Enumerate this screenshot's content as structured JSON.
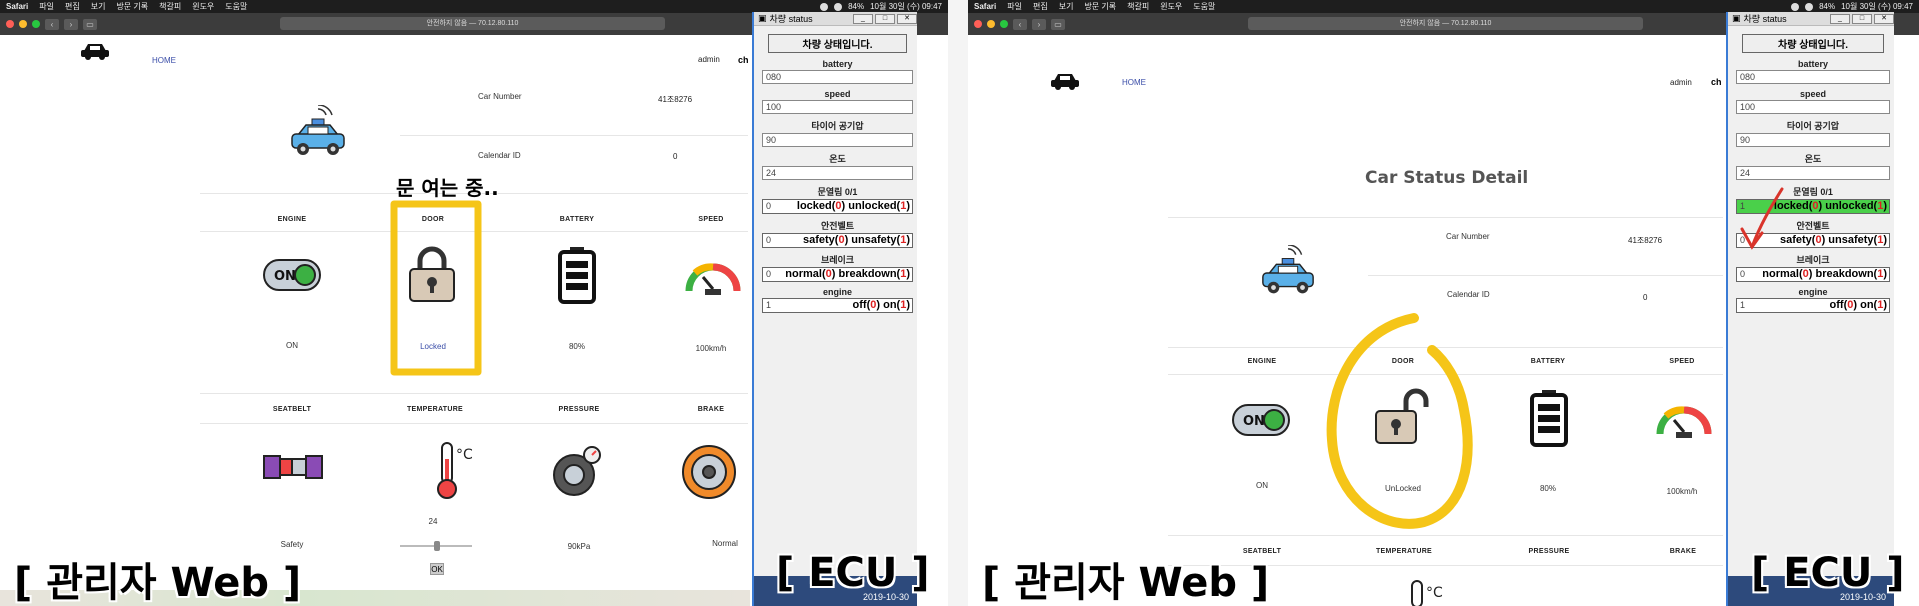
{
  "menubar": {
    "app": "Safari",
    "items": [
      "파일",
      "편집",
      "보기",
      "방문 기록",
      "책갈피",
      "윈도우",
      "도움말"
    ],
    "battery": "84%",
    "datetime": "10월 30일 (수) 09:47"
  },
  "browser": {
    "url": "안전하지 않음 — 70.12.80.110"
  },
  "nav": {
    "home": "HOME",
    "admin": "admin",
    "truncated": "ch"
  },
  "page": {
    "title": "Car Status Detail",
    "car_number_label": "Car Number",
    "car_number_value": "41조8276",
    "calendar_label": "Calendar ID",
    "calendar_value": "0"
  },
  "status_row1": {
    "headers": [
      "ENGINE",
      "DOOR",
      "BATTERY",
      "SPEED"
    ],
    "left_values": [
      "ON",
      "Locked",
      "80%",
      "100km/h"
    ],
    "right_values": [
      "ON",
      "UnLocked",
      "80%",
      "100km/h"
    ]
  },
  "status_row2": {
    "headers": [
      "SEATBELT",
      "TEMPERATURE",
      "PRESSURE",
      "BRAKE"
    ],
    "values": [
      "Safety",
      "",
      "90kPa",
      "Normal"
    ],
    "temperature_value": "24",
    "ok_button": "OK"
  },
  "ecu": {
    "window_title": "차량 status",
    "header": "차량 상태입니다.",
    "battery_label": "battery",
    "battery_value": "080",
    "speed_label": "speed",
    "speed_value": "100",
    "tire_label": "타이어 공기압",
    "tire_value": "90",
    "temp_label": "온도",
    "temp_value": "24",
    "door_label": "문열림 0/1",
    "door_left_value": "0",
    "door_right_value": "1",
    "door_opt_a": "locked(",
    "door_opt_b": "0",
    "door_opt_c": ") unlocked(",
    "door_opt_d": "1",
    "door_opt_e": ")",
    "belt_label": "안전벨트",
    "belt_value": "0",
    "belt_opt_a": "safety(",
    "belt_opt_b": "0",
    "belt_opt_c": ") unsafety(",
    "belt_opt_d": "1",
    "belt_opt_e": ")",
    "brake_label": "브레이크",
    "brake_value": "0",
    "brake_opt_a": "normal(",
    "brake_opt_b": "0",
    "brake_opt_c": ") breakdown(",
    "brake_opt_d": "1",
    "brake_opt_e": ")",
    "engine_label": "engine",
    "engine_value": "1",
    "engine_opt_a": "off(",
    "engine_opt_b": "0",
    "engine_opt_c": ") on(",
    "engine_opt_d": "1",
    "engine_opt_e": ")",
    "taskbar_date": "2019-10-30"
  },
  "overlays": {
    "left_admin": "[ 관리자 Web ]",
    "left_ecu": "[ ECU ]",
    "right_admin": "[ 관리자 Web ]",
    "right_ecu": "[ ECU ]",
    "door_opening": "문 여는 중.."
  },
  "colors": {
    "highlight_yellow": "#f5c518",
    "accent_green": "#4ad04a",
    "arrow_red": "#d9342b"
  }
}
